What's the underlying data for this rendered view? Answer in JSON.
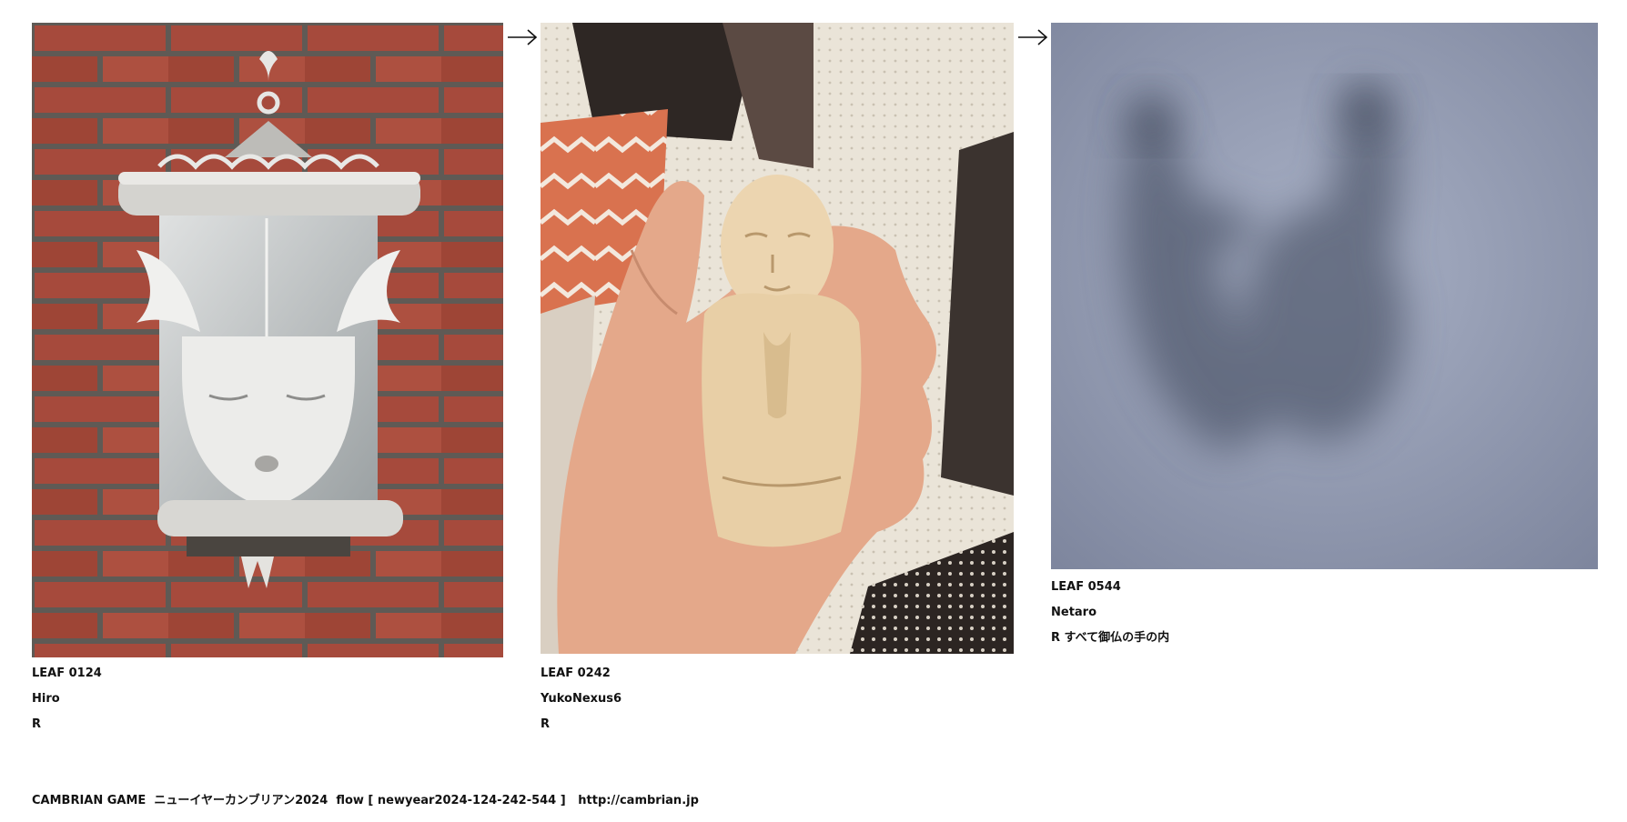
{
  "leaves": [
    {
      "number": "LEAF 0124",
      "author": "Hiro",
      "note": "R",
      "photo_subject": "white-cherub-wall-lantern"
    },
    {
      "number": "LEAF 0242",
      "author": "YukoNexus6",
      "note": "R",
      "photo_subject": "carved-wooden-jizo-figure"
    },
    {
      "number": "LEAF 0544",
      "author": "Netaro",
      "note": "R すべて御仏の手の内",
      "photo_subject": "blurred-hand-shadow"
    }
  ],
  "arrow_icon": "right-arrow-icon",
  "footer": {
    "game": "CAMBRIAN GAME",
    "title": "ニューイヤーカンブリアン2024",
    "flow": "flow [ newyear2024-124-242-544 ]",
    "url": "http://cambrian.jp"
  }
}
